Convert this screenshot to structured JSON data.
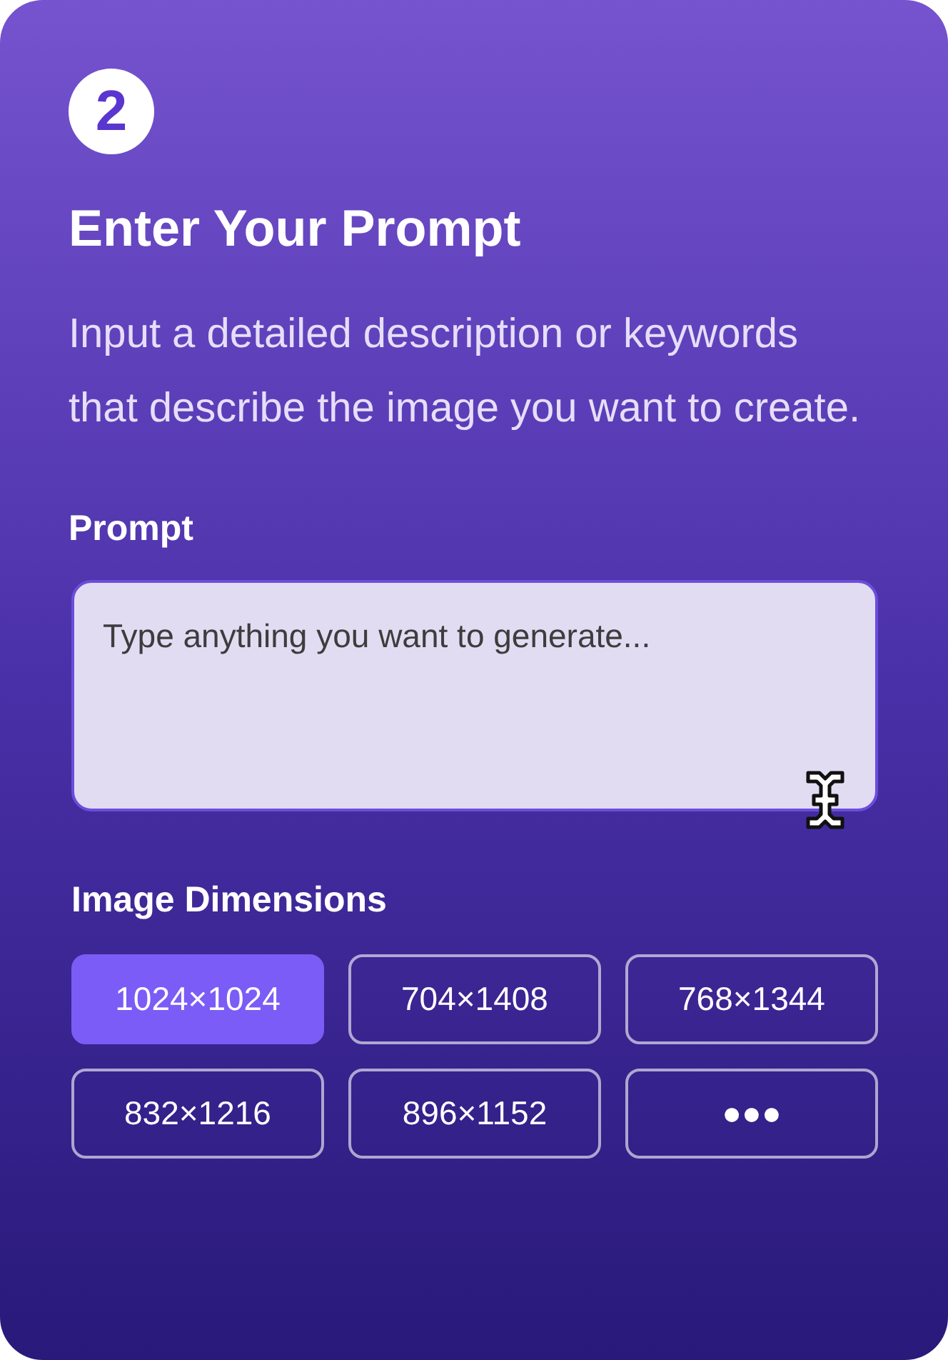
{
  "step": "2",
  "title": "Enter Your Prompt",
  "description": "Input a detailed description or keywords that describe the image you want to create.",
  "prompt": {
    "label": "Prompt",
    "placeholder": "Type anything you want to generate..."
  },
  "dimensions": {
    "label": "Image Dimensions",
    "options": [
      {
        "label": "1024×1024",
        "selected": true
      },
      {
        "label": "704×1408",
        "selected": false
      },
      {
        "label": "768×1344",
        "selected": false
      },
      {
        "label": "832×1216",
        "selected": false
      },
      {
        "label": "896×1152",
        "selected": false
      },
      {
        "label": "●●●",
        "selected": false
      }
    ]
  }
}
